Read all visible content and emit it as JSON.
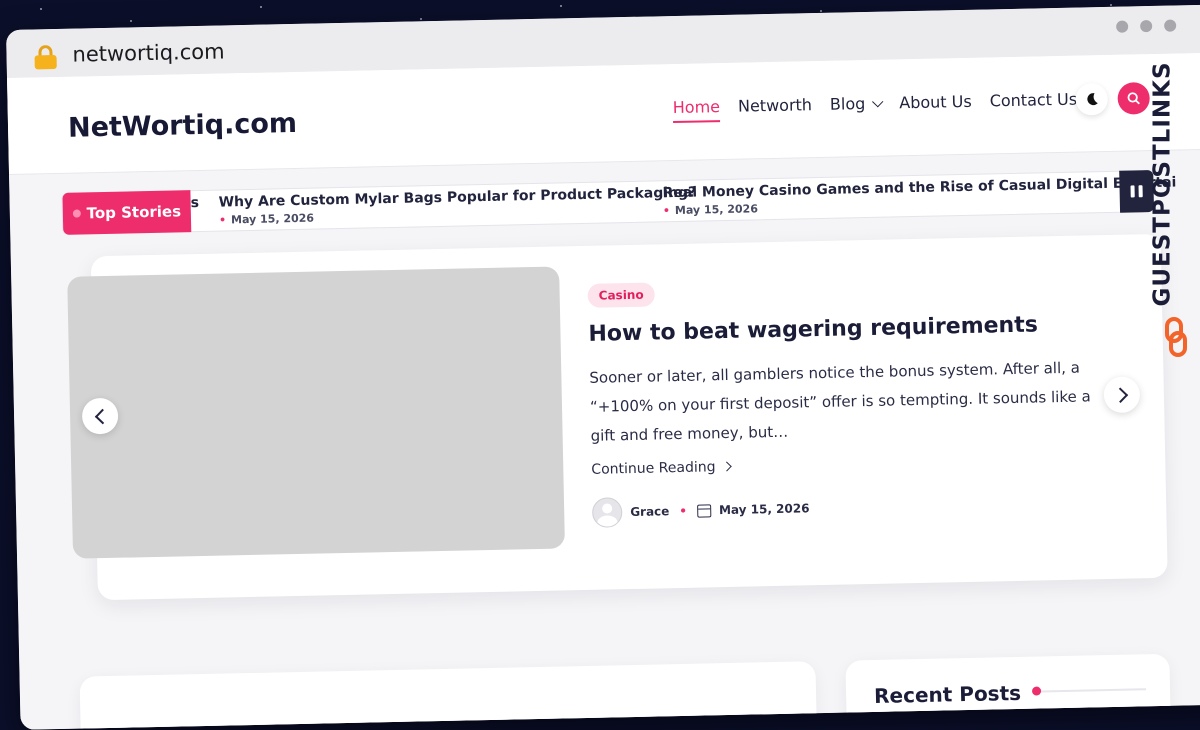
{
  "browser": {
    "url": "networtiq.com"
  },
  "site": {
    "logo": "NetWortiq.com",
    "nav": [
      "Home",
      "Networth",
      "Blog",
      "About Us",
      "Contact Us"
    ],
    "active_nav": "Home"
  },
  "ticker": {
    "label": "Top Stories",
    "cut_text": "s",
    "stories": [
      {
        "title": "Why Are Custom Mylar Bags Popular for Product Packaging?",
        "date": "May 15, 2026"
      },
      {
        "title": "Real Money Casino Games and the Rise of Casual Digital Entertai",
        "date": "May 15, 2026"
      }
    ]
  },
  "featured": {
    "category": "Casino",
    "title": "How to beat wagering requirements",
    "excerpt": "Sooner or later, all gamblers notice the bonus system. After all, a “+100% on your first deposit” offer is so tempting. It sounds like a gift and free money, but…",
    "continue_label": "Continue Reading",
    "author": "Grace",
    "date": "May 15, 2026"
  },
  "sidebar": {
    "recent_title": "Recent Posts"
  },
  "watermark": {
    "text": "GUESTPOSTLINKS"
  },
  "colors": {
    "accent": "#ee2d6c",
    "dark": "#22243e"
  },
  "icons": [
    "lock-icon",
    "moon-icon",
    "search-icon",
    "pause-icon",
    "chevron-left-icon",
    "chevron-right-icon",
    "calendar-icon",
    "chain-link-icon"
  ]
}
